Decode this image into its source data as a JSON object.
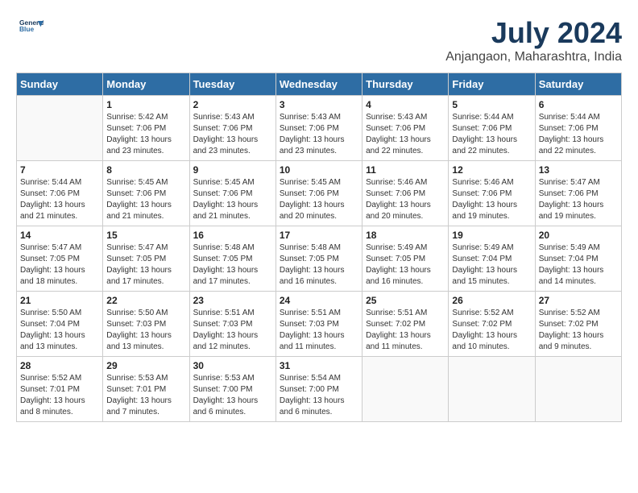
{
  "logo": {
    "line1": "General",
    "line2": "Blue"
  },
  "title": "July 2024",
  "location": "Anjangaon, Maharashtra, India",
  "weekdays": [
    "Sunday",
    "Monday",
    "Tuesday",
    "Wednesday",
    "Thursday",
    "Friday",
    "Saturday"
  ],
  "weeks": [
    [
      {
        "day": "",
        "info": ""
      },
      {
        "day": "1",
        "info": "Sunrise: 5:42 AM\nSunset: 7:06 PM\nDaylight: 13 hours\nand 23 minutes."
      },
      {
        "day": "2",
        "info": "Sunrise: 5:43 AM\nSunset: 7:06 PM\nDaylight: 13 hours\nand 23 minutes."
      },
      {
        "day": "3",
        "info": "Sunrise: 5:43 AM\nSunset: 7:06 PM\nDaylight: 13 hours\nand 23 minutes."
      },
      {
        "day": "4",
        "info": "Sunrise: 5:43 AM\nSunset: 7:06 PM\nDaylight: 13 hours\nand 22 minutes."
      },
      {
        "day": "5",
        "info": "Sunrise: 5:44 AM\nSunset: 7:06 PM\nDaylight: 13 hours\nand 22 minutes."
      },
      {
        "day": "6",
        "info": "Sunrise: 5:44 AM\nSunset: 7:06 PM\nDaylight: 13 hours\nand 22 minutes."
      }
    ],
    [
      {
        "day": "7",
        "info": "Sunrise: 5:44 AM\nSunset: 7:06 PM\nDaylight: 13 hours\nand 21 minutes."
      },
      {
        "day": "8",
        "info": "Sunrise: 5:45 AM\nSunset: 7:06 PM\nDaylight: 13 hours\nand 21 minutes."
      },
      {
        "day": "9",
        "info": "Sunrise: 5:45 AM\nSunset: 7:06 PM\nDaylight: 13 hours\nand 21 minutes."
      },
      {
        "day": "10",
        "info": "Sunrise: 5:45 AM\nSunset: 7:06 PM\nDaylight: 13 hours\nand 20 minutes."
      },
      {
        "day": "11",
        "info": "Sunrise: 5:46 AM\nSunset: 7:06 PM\nDaylight: 13 hours\nand 20 minutes."
      },
      {
        "day": "12",
        "info": "Sunrise: 5:46 AM\nSunset: 7:06 PM\nDaylight: 13 hours\nand 19 minutes."
      },
      {
        "day": "13",
        "info": "Sunrise: 5:47 AM\nSunset: 7:06 PM\nDaylight: 13 hours\nand 19 minutes."
      }
    ],
    [
      {
        "day": "14",
        "info": "Sunrise: 5:47 AM\nSunset: 7:05 PM\nDaylight: 13 hours\nand 18 minutes."
      },
      {
        "day": "15",
        "info": "Sunrise: 5:47 AM\nSunset: 7:05 PM\nDaylight: 13 hours\nand 17 minutes."
      },
      {
        "day": "16",
        "info": "Sunrise: 5:48 AM\nSunset: 7:05 PM\nDaylight: 13 hours\nand 17 minutes."
      },
      {
        "day": "17",
        "info": "Sunrise: 5:48 AM\nSunset: 7:05 PM\nDaylight: 13 hours\nand 16 minutes."
      },
      {
        "day": "18",
        "info": "Sunrise: 5:49 AM\nSunset: 7:05 PM\nDaylight: 13 hours\nand 16 minutes."
      },
      {
        "day": "19",
        "info": "Sunrise: 5:49 AM\nSunset: 7:04 PM\nDaylight: 13 hours\nand 15 minutes."
      },
      {
        "day": "20",
        "info": "Sunrise: 5:49 AM\nSunset: 7:04 PM\nDaylight: 13 hours\nand 14 minutes."
      }
    ],
    [
      {
        "day": "21",
        "info": "Sunrise: 5:50 AM\nSunset: 7:04 PM\nDaylight: 13 hours\nand 13 minutes."
      },
      {
        "day": "22",
        "info": "Sunrise: 5:50 AM\nSunset: 7:03 PM\nDaylight: 13 hours\nand 13 minutes."
      },
      {
        "day": "23",
        "info": "Sunrise: 5:51 AM\nSunset: 7:03 PM\nDaylight: 13 hours\nand 12 minutes."
      },
      {
        "day": "24",
        "info": "Sunrise: 5:51 AM\nSunset: 7:03 PM\nDaylight: 13 hours\nand 11 minutes."
      },
      {
        "day": "25",
        "info": "Sunrise: 5:51 AM\nSunset: 7:02 PM\nDaylight: 13 hours\nand 11 minutes."
      },
      {
        "day": "26",
        "info": "Sunrise: 5:52 AM\nSunset: 7:02 PM\nDaylight: 13 hours\nand 10 minutes."
      },
      {
        "day": "27",
        "info": "Sunrise: 5:52 AM\nSunset: 7:02 PM\nDaylight: 13 hours\nand 9 minutes."
      }
    ],
    [
      {
        "day": "28",
        "info": "Sunrise: 5:52 AM\nSunset: 7:01 PM\nDaylight: 13 hours\nand 8 minutes."
      },
      {
        "day": "29",
        "info": "Sunrise: 5:53 AM\nSunset: 7:01 PM\nDaylight: 13 hours\nand 7 minutes."
      },
      {
        "day": "30",
        "info": "Sunrise: 5:53 AM\nSunset: 7:00 PM\nDaylight: 13 hours\nand 6 minutes."
      },
      {
        "day": "31",
        "info": "Sunrise: 5:54 AM\nSunset: 7:00 PM\nDaylight: 13 hours\nand 6 minutes."
      },
      {
        "day": "",
        "info": ""
      },
      {
        "day": "",
        "info": ""
      },
      {
        "day": "",
        "info": ""
      }
    ]
  ]
}
